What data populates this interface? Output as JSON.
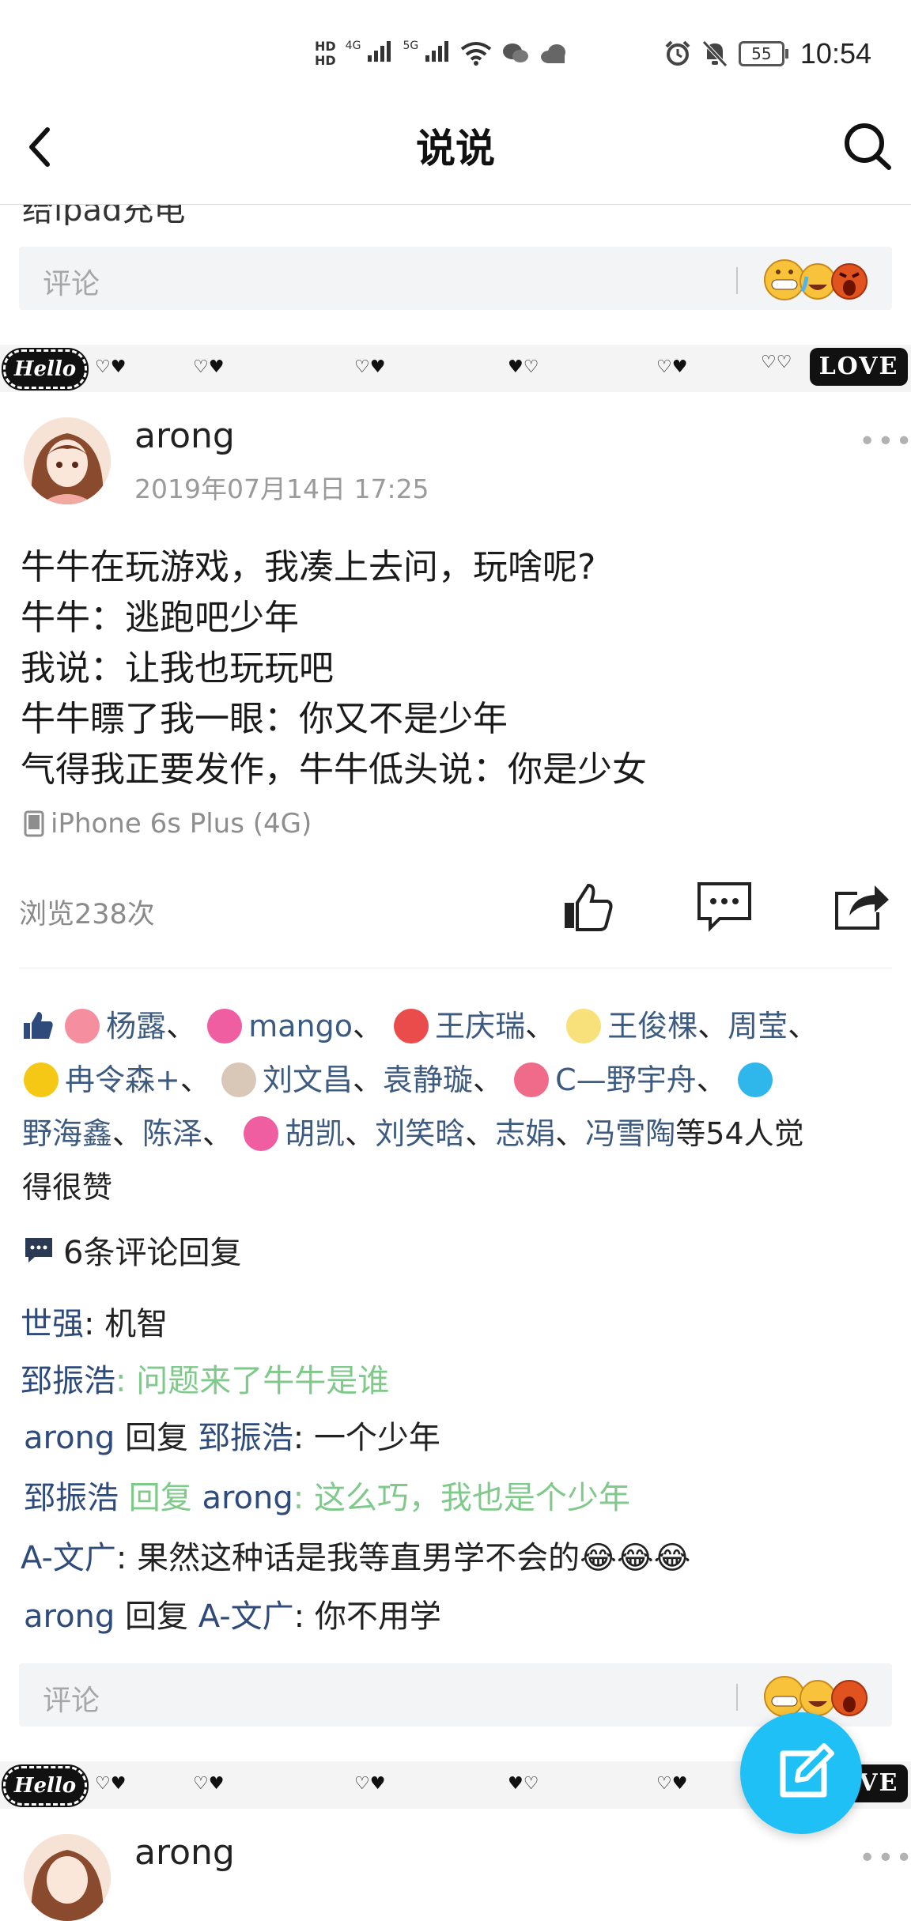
{
  "status_bar": {
    "time": "10:54",
    "battery": "55",
    "icons": [
      "hd-icon",
      "signal-4g-icon",
      "signal-5g-icon",
      "wifi-icon",
      "wechat-icon",
      "cloud-icon",
      "alarm-icon",
      "mute-icon",
      "battery-icon"
    ],
    "sim_labels": [
      "4G",
      "5G"
    ]
  },
  "header": {
    "title": "说说",
    "back_icon": "chevron-left-icon",
    "search_icon": "search-icon"
  },
  "previous_post": {
    "cut_text": "给ipad充电",
    "comment_placeholder": "评论"
  },
  "strip": {
    "hello": "Hello",
    "love": "LOVE",
    "hearts": [
      "♡♥",
      "♡♥",
      "♡♥",
      "♥♡",
      "♡♥",
      "♡♡"
    ]
  },
  "post": {
    "author": "arong",
    "time": "2019年07月14日 17:25",
    "more_label": "•••",
    "content_lines": [
      "牛牛在玩游戏，我凑上去问，玩啥呢?",
      "牛牛：逃跑吧少年",
      "我说：让我也玩玩吧",
      "牛牛瞟了我一眼：你又不是少年",
      "气得我正要发作，牛牛低头说：你是少女"
    ],
    "device": "iPhone 6s Plus (4G)",
    "views": "浏览238次",
    "likes": {
      "line1": [
        "杨露",
        "mango",
        "王庆瑞",
        "王俊棵",
        "周莹"
      ],
      "line2": [
        "冉令森+",
        "刘文昌",
        "袁静璇",
        "C—野宇舟"
      ],
      "line3": [
        "野海鑫",
        "陈泽",
        "胡凯",
        "刘笑晗",
        "志娟",
        "冯雪陶"
      ],
      "suffix_a": "等54人觉",
      "suffix_b": "得很赞",
      "sep": "、"
    },
    "reply_count": "6条评论回复",
    "comments": [
      {
        "name": "世强",
        "colon": ": ",
        "text": "机智"
      },
      {
        "name": "郅振浩",
        "colon": ": ",
        "text": "问题来了牛牛是谁"
      },
      {
        "name": "arong",
        "reply": " 回复 ",
        "target": "郅振浩",
        "colon": ":  ",
        "text": "一个少年"
      },
      {
        "name": "郅振浩",
        "reply": " 回复 ",
        "target": "arong",
        "colon": ": ",
        "text": "这么巧，我也是个少年"
      },
      {
        "name": "A-文广",
        "colon": ": ",
        "text": "果然这种话是我等直男学不会的😂😂😂"
      },
      {
        "name": "arong",
        "reply": " 回复 ",
        "target": "A-文广",
        "colon": ":  ",
        "text": "你不用学"
      }
    ],
    "comment_placeholder": "评论"
  },
  "next_post": {
    "author": "arong"
  },
  "fab_icon": "edit-icon",
  "colors": {
    "name_blue": "#2f4b7c",
    "reply_green": "#7fc98a",
    "fab": "#1ec0f5"
  }
}
